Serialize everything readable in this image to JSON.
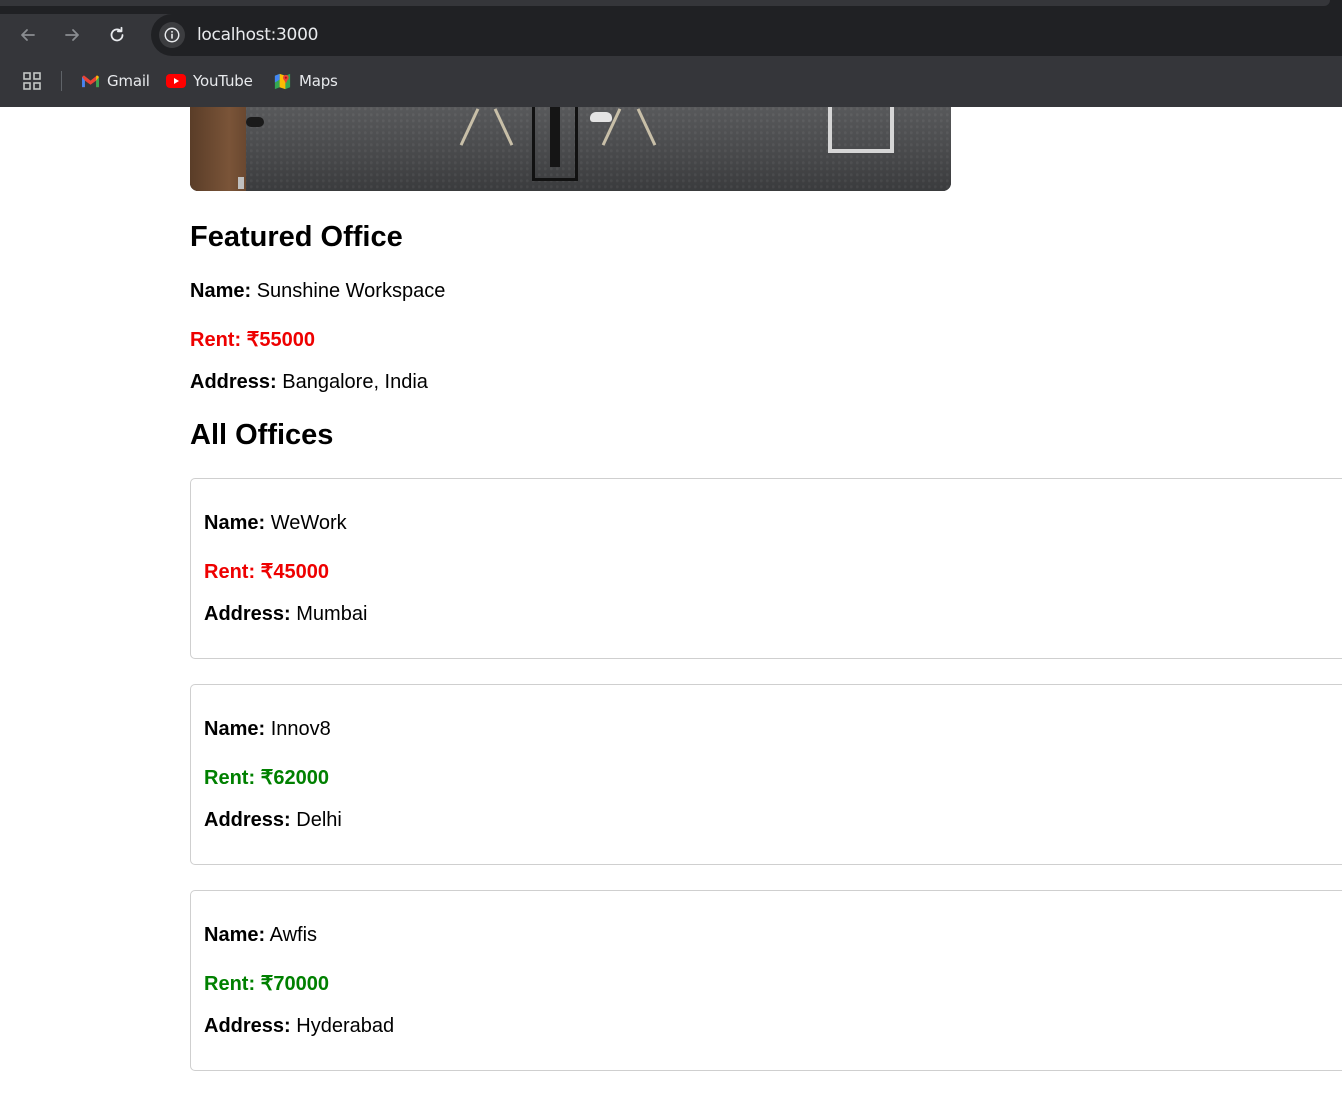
{
  "browser": {
    "url": "localhost:3000",
    "bookmarks": [
      {
        "label": "Gmail",
        "icon": "gmail-icon"
      },
      {
        "label": "YouTube",
        "icon": "youtube-icon"
      },
      {
        "label": "Maps",
        "icon": "maps-icon"
      }
    ]
  },
  "featured": {
    "heading": "Featured Office",
    "name_label": "Name:",
    "name": "Sunshine Workspace",
    "rent_text": "Rent: ₹55000",
    "rent_color": "#ee0000",
    "address_label": "Address:",
    "address": "Bangalore, India"
  },
  "all_offices": {
    "heading": "All Offices",
    "items": [
      {
        "name_label": "Name:",
        "name": "WeWork",
        "rent_text": "Rent: ₹45000",
        "rent_color": "#ee0000",
        "address_label": "Address:",
        "address": "Mumbai"
      },
      {
        "name_label": "Name:",
        "name": "Innov8",
        "rent_text": "Rent: ₹62000",
        "rent_color": "#008000",
        "address_label": "Address:",
        "address": "Delhi"
      },
      {
        "name_label": "Name:",
        "name": "Awfis",
        "rent_text": "Rent: ₹70000",
        "rent_color": "#008000",
        "address_label": "Address:",
        "address": "Hyderabad"
      }
    ]
  }
}
